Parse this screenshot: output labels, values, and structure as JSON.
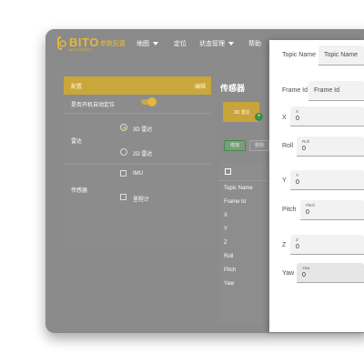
{
  "brand": {
    "name": "BITO",
    "subtitle": "BITO ROBOT"
  },
  "nav": [
    {
      "label": "参数配置",
      "active": true,
      "dropdown": false
    },
    {
      "label": "地图",
      "active": false,
      "dropdown": true
    },
    {
      "label": "定位",
      "active": false,
      "dropdown": false
    },
    {
      "label": "状态管理",
      "active": false,
      "dropdown": true
    },
    {
      "label": "帮助",
      "active": false,
      "dropdown": false
    }
  ],
  "left_card": {
    "header_left": "配置",
    "header_right": "编辑",
    "auto_locate_label": "是否开机自动定位",
    "auto_locate_on": true,
    "lidar_label": "雷达",
    "lidar_options": [
      {
        "label": "3D 雷达",
        "checked": true
      },
      {
        "label": "2D 雷达",
        "checked": false
      }
    ],
    "sensor_label": "传感器",
    "sensor_options": [
      {
        "label": "IMU",
        "checked": false
      },
      {
        "label": "里程计",
        "checked": false
      }
    ]
  },
  "sensors": {
    "title": "传感器",
    "tile_label": "3D 雷达",
    "badge": "+",
    "add_label": "增加",
    "delete_label": "删除",
    "list_rows": [
      "Topic Name",
      "Frame Id",
      "X",
      "Y",
      "Z",
      "Roll",
      "Pitch",
      "Yaw"
    ]
  },
  "panel": {
    "fields": [
      {
        "name": "Topic Name",
        "label": "",
        "value": "",
        "placeholder": "Topic Name"
      },
      {
        "name": "Frame Id",
        "label": "",
        "value": "",
        "placeholder": "Frame Id"
      },
      {
        "name": "X",
        "label": "X",
        "value": "0"
      },
      {
        "name": "Roll",
        "label": "Roll",
        "value": "0"
      },
      {
        "name": "Y",
        "label": "Y",
        "value": "0"
      },
      {
        "name": "Pitch",
        "label": "Pitch",
        "value": "0"
      },
      {
        "name": "Z",
        "label": "Z",
        "value": "0"
      },
      {
        "name": "Yaw",
        "label": "Yaw",
        "value": "0"
      }
    ]
  },
  "colors": {
    "accent": "#e5b73a",
    "overlay": "#8b8b8b",
    "success": "#3b8d4a"
  }
}
